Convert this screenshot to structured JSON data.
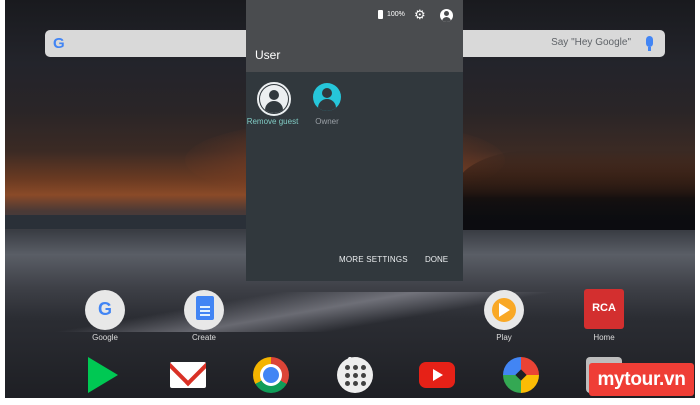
{
  "search": {
    "logo": "G",
    "hint": "Say \"Hey Google\"",
    "mic_icon": "mic-icon"
  },
  "panel": {
    "battery_text": "100%",
    "title": "User",
    "users": [
      {
        "label": "Remove guest",
        "icon": "guest-avatar-icon"
      },
      {
        "label": "Owner",
        "icon": "owner-avatar-icon"
      }
    ],
    "more_settings": "MORE SETTINGS",
    "done": "DONE"
  },
  "home_apps": [
    {
      "label": "Google"
    },
    {
      "label": "Create"
    },
    {
      "label": "Play"
    },
    {
      "label": "Home",
      "logo_text": "RCA"
    }
  ],
  "dock": [
    "play-store-icon",
    "gmail-icon",
    "chrome-icon",
    "app-drawer-icon",
    "youtube-icon",
    "photos-icon",
    "app-icon"
  ],
  "watermark": "mytour.vn",
  "colors": {
    "accent": "#26c6da",
    "panel_header": "#4a4c4f",
    "panel_body": "#31383d",
    "watermark_bg": "#ef3e36"
  }
}
